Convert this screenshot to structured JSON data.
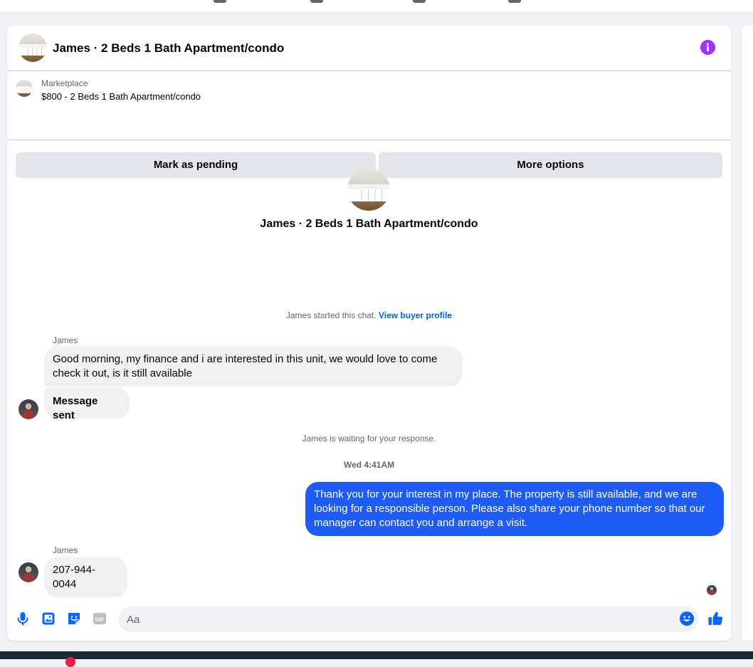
{
  "header": {
    "title": "James · 2 Beds 1 Bath Apartment/condo"
  },
  "listing": {
    "label": "Marketplace",
    "price_title": "$800 - 2 Beds 1 Bath Apartment/condo",
    "mark_pending_label": "Mark as pending",
    "more_options_label": "More options"
  },
  "intro": {
    "title": "James · 2 Beds 1 Bath Apartment/condo",
    "started_text": "James started this chat.",
    "view_profile_link": "View buyer profile"
  },
  "messages": [
    {
      "sender": "James",
      "text": "Good morning, my finance and i are interested in this unit, we would love to come check it out, is it still available"
    },
    {
      "text": "Message sent"
    }
  ],
  "waiting_text": "James is waiting for your response.",
  "timestamp": "Wed 4:41AM",
  "outgoing": {
    "text": "Thank you for your interest in my place. The property is still available, and we are looking for a responsible person. Please also share your phone number so that our manager can contact you and arrange a visit."
  },
  "reply": {
    "sender": "James",
    "text": "207-944-0044"
  },
  "composer": {
    "placeholder": "Aa",
    "icons": [
      "microphone-icon",
      "image-icon",
      "sticker-icon",
      "gif-icon",
      "emoji-icon",
      "thumbs-up-icon"
    ]
  },
  "colors": {
    "accent": "#0866ff",
    "outgoing_bubble": "#1f5cf5",
    "info": "#a033ff",
    "incoming_bubble": "#f0f0f0"
  }
}
